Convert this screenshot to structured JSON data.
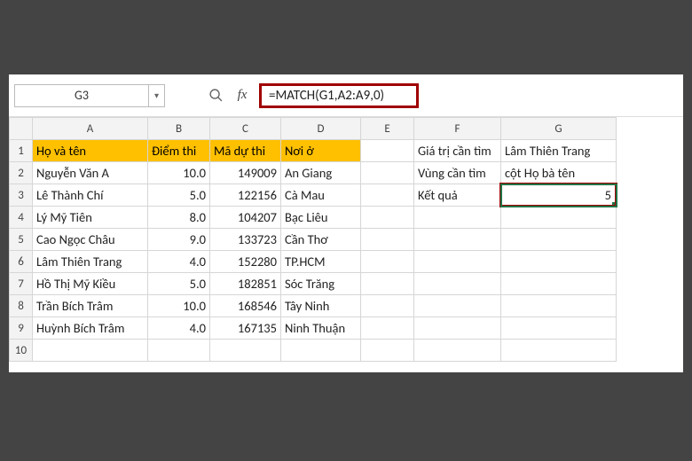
{
  "namebox": {
    "value": "G3"
  },
  "formula": "=MATCH(G1,A2:A9,0)",
  "columns": [
    "A",
    "B",
    "C",
    "D",
    "E",
    "F",
    "G"
  ],
  "row_numbers": [
    "1",
    "2",
    "3",
    "4",
    "5",
    "6",
    "7",
    "8",
    "9",
    "10"
  ],
  "headers": {
    "A": "Họ và tên",
    "B": "Điểm thi",
    "C": "Mã dự thi",
    "D": "Nơi ở"
  },
  "rows": [
    {
      "name": "Nguyễn Văn A",
      "score": "10.0",
      "code": "149009",
      "place": "An Giang"
    },
    {
      "name": "Lê Thành Chí",
      "score": "5.0",
      "code": "122156",
      "place": "Cà Mau"
    },
    {
      "name": "Lý Mỹ Tiên",
      "score": "8.0",
      "code": "104207",
      "place": "Bạc Liêu"
    },
    {
      "name": "Cao Ngọc Châu",
      "score": "9.0",
      "code": "133723",
      "place": "Cần Thơ"
    },
    {
      "name": "Lâm Thiên Trang",
      "score": "4.0",
      "code": "152280",
      "place": "TP.HCM"
    },
    {
      "name": "Hồ Thị Mỹ Kiều",
      "score": "5.0",
      "code": "182851",
      "place": "Sóc Trăng"
    },
    {
      "name": "Trần Bích Trâm",
      "score": "10.0",
      "code": "168546",
      "place": "Tây Ninh"
    },
    {
      "name": "Huỳnh Bích Trâm",
      "score": "4.0",
      "code": "167135",
      "place": "Ninh Thuận"
    }
  ],
  "side": {
    "f1": "Giá trị cần tìm",
    "f2": "Vùng cần tìm",
    "f3": "Kết quả",
    "g1": "Lâm Thiên Trang",
    "g2": "cột Họ bà tên",
    "g3": "5"
  },
  "chart_data": {
    "type": "table",
    "title": "",
    "columns": [
      "Họ và tên",
      "Điểm thi",
      "Mã dự thi",
      "Nơi ở"
    ],
    "records": [
      [
        "Nguyễn Văn A",
        10.0,
        149009,
        "An Giang"
      ],
      [
        "Lê Thành Chí",
        5.0,
        122156,
        "Cà Mau"
      ],
      [
        "Lý Mỹ Tiên",
        8.0,
        104207,
        "Bạc Liêu"
      ],
      [
        "Cao Ngọc Châu",
        9.0,
        133723,
        "Cần Thơ"
      ],
      [
        "Lâm Thiên Trang",
        4.0,
        152280,
        "TP.HCM"
      ],
      [
        "Hồ Thị Mỹ Kiều",
        5.0,
        182851,
        "Sóc Trăng"
      ],
      [
        "Trần Bích Trâm",
        10.0,
        168546,
        "Tây Ninh"
      ],
      [
        "Huỳnh Bích Trâm",
        4.0,
        167135,
        "Ninh Thuận"
      ]
    ],
    "lookup": {
      "formula": "=MATCH(G1,A2:A9,0)",
      "search_value": "Lâm Thiên Trang",
      "result": 5
    }
  }
}
